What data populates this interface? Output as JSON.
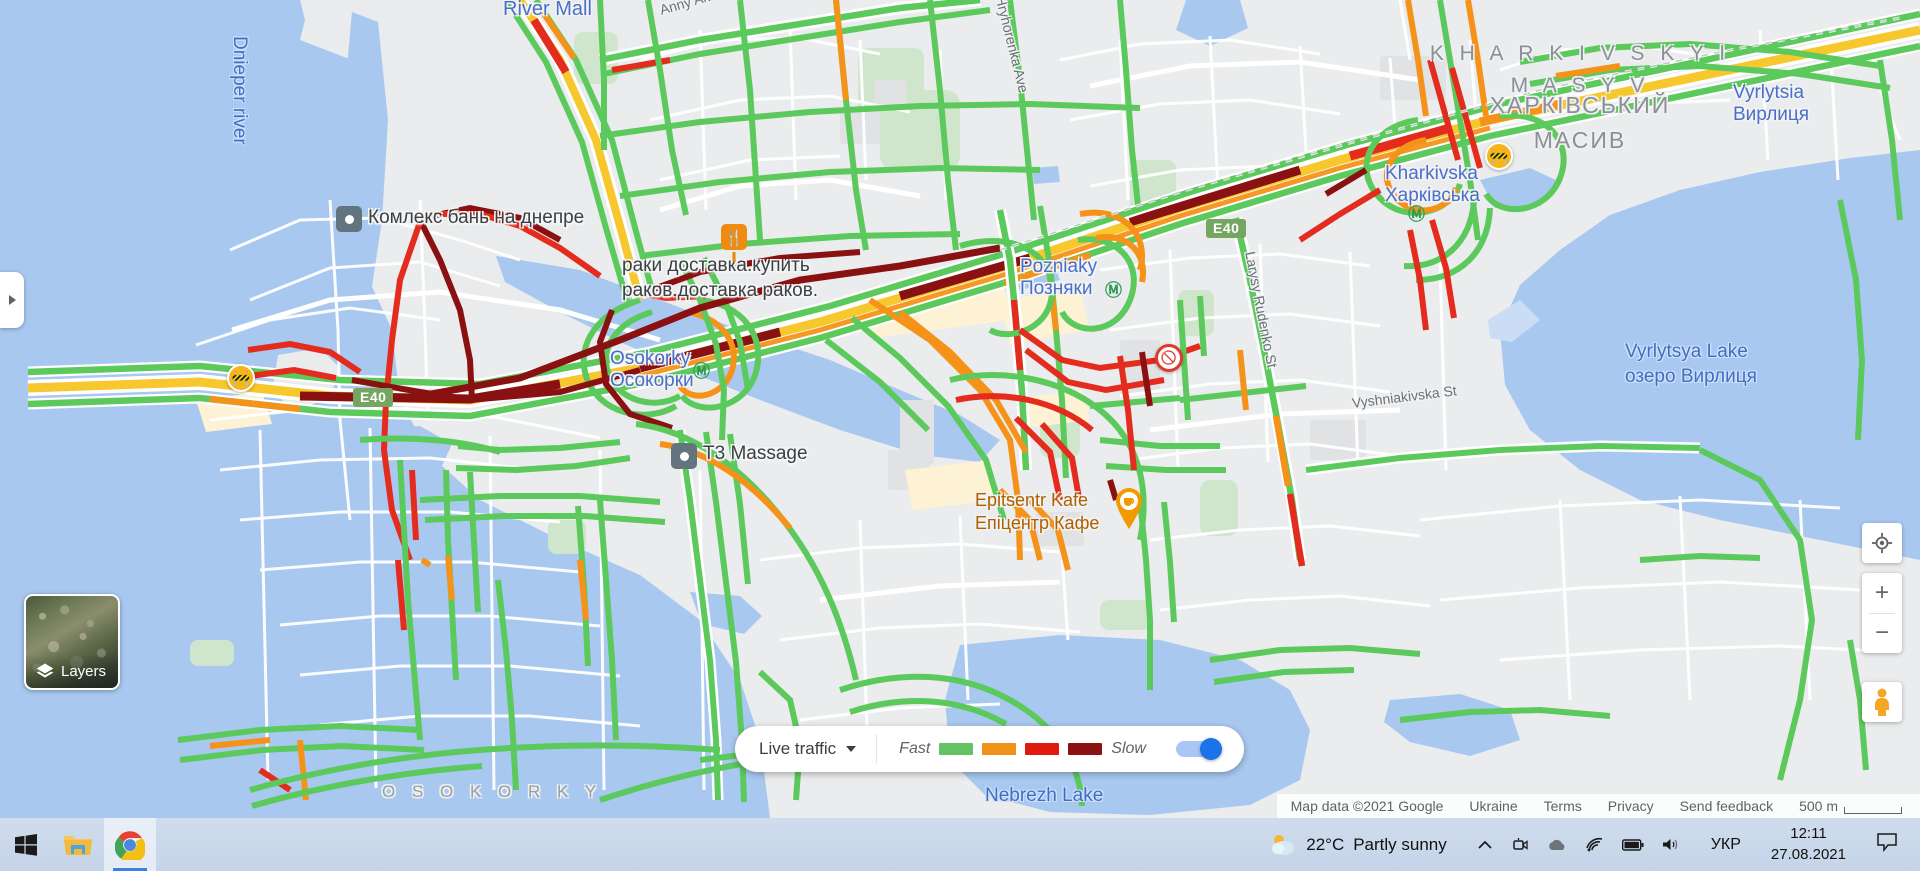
{
  "map": {
    "labels": {
      "river": "Dnieper river",
      "river_mall": "River Mall",
      "anny_akhm": "Anny Akhm",
      "hnylorenka": "Hryhorenka Ave",
      "komplex_bath": "Комлекс бань на днепре",
      "crayfish": "раки доставка.купить\nраков.доставка раков.",
      "osokorky_en": "Osokorky",
      "osokorky_uk": "Осокорки",
      "poznyaky_en": "Pozniaky",
      "poznyaky_uk": "Позняки",
      "kharkivskyi_en": "K H A R K I V S K Y I\nM A S Y V",
      "kharkivskyi_uk": "ХАРКІВСЬКИЙ\nМАСИВ",
      "kharkivska_en": "Kharkivska",
      "kharkivska_uk": "Харківська",
      "vyrlytsia_en": "Vyrlytsia",
      "vyrlytsia_uk": "Вирлиця",
      "vyrlytsya_lake_en": "Vyrlytsya Lake",
      "vyrlytsya_lake_uk": "озеро Вирлиця",
      "t3_massage": "T3 Massage",
      "epitsentr_en": "Epitsentr Kafe",
      "epitsentr_uk": "Епіцентр Кафе",
      "larysy_rudenko": "Larysy Rudenko St",
      "vyshniakivska": "Vyshniakivska St",
      "osokorky_district": "O S O K O R K Y",
      "nebrezh_lake": "Nebrezh Lake",
      "e40_a": "E40",
      "e40_b": "E40"
    },
    "colors": {
      "traffic_fast": "#5cc95c",
      "traffic_moderate": "#f59219",
      "traffic_slow": "#e32b1e",
      "traffic_jam": "#8a1111",
      "water": "#a8c8f0",
      "land": "#eaeced",
      "park": "#cfe6cc"
    }
  },
  "panel_tab": {
    "name": "expand-side-panel"
  },
  "layers": {
    "label": "Layers"
  },
  "traffic_bar": {
    "select_label": "Live traffic",
    "fast_label": "Fast",
    "slow_label": "Slow",
    "swatches": [
      "#63c363",
      "#f09218",
      "#e01b0e",
      "#8b1112"
    ],
    "toggle_on": true
  },
  "map_controls": {
    "locate_label": "Show your location",
    "zoom_in_label": "+",
    "zoom_out_label": "−",
    "pegman_label": "Street View"
  },
  "attribution": {
    "copyright": "Map data ©2021 Google",
    "links": [
      "Ukraine",
      "Terms",
      "Privacy",
      "Send feedback"
    ],
    "scale": "500 m"
  },
  "taskbar": {
    "apps": [
      {
        "name": "start-button",
        "label": "Start"
      },
      {
        "name": "file-explorer",
        "label": "File Explorer"
      },
      {
        "name": "google-chrome",
        "label": "Google Chrome",
        "active": true
      }
    ],
    "weather": {
      "temperature": "22°C",
      "condition": "Partly sunny"
    },
    "tray": [
      {
        "name": "show-hidden-icons",
        "glyph": "⌃"
      },
      {
        "name": "camera-icon",
        "glyph": "▣"
      },
      {
        "name": "onedrive-icon",
        "glyph": "☁"
      },
      {
        "name": "wifi-icon",
        "glyph": "◞"
      },
      {
        "name": "battery-icon",
        "glyph": "▮"
      },
      {
        "name": "volume-icon",
        "glyph": "🔊"
      }
    ],
    "language": "УКР",
    "clock": {
      "time": "12:11",
      "date": "27.08.2021"
    },
    "notifications_label": "Notifications"
  }
}
